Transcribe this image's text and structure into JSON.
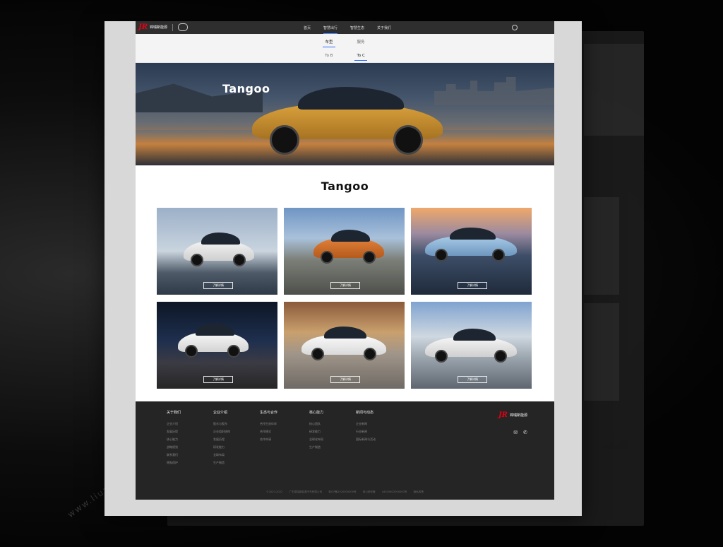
{
  "header": {
    "logo_mark": "JR",
    "logo_text": "锦瑞新能源",
    "nav": [
      "首页",
      "智慧出行",
      "智慧生态",
      "关于我们"
    ],
    "active_nav": 1
  },
  "tabs_primary": [
    "车型",
    "服务"
  ],
  "tabs_secondary": [
    "To B",
    "To C"
  ],
  "hero": {
    "brand": "Tangoo"
  },
  "section": {
    "title": "Tangoo"
  },
  "cards": [
    {
      "button": "了解详情"
    },
    {
      "button": "了解详情"
    },
    {
      "button": "了解详情"
    },
    {
      "button": "了解详情"
    },
    {
      "button": "了解详情"
    },
    {
      "button": "了解详情"
    }
  ],
  "footer": {
    "columns": [
      {
        "heading": "关于我们",
        "items": [
          "企业介绍",
          "发展历程",
          "核心能力",
          "战略规划",
          "联系我们",
          "隐私保护"
        ]
      },
      {
        "heading": "企业介绍",
        "items": [
          "股东与股东",
          "企业组织结构",
          "发展历程",
          "研发能力",
          "全球布局",
          "生产制造"
        ]
      },
      {
        "heading": "生态与合作",
        "items": [
          "合作生态伙伴",
          "合作模式",
          "合作申请"
        ]
      },
      {
        "heading": "核心能力",
        "items": [
          "核心团队",
          "研发能力",
          "全球化布局",
          "生产制造"
        ]
      },
      {
        "heading": "新闻与动态",
        "items": [
          "企业新闻",
          "行业新闻",
          "国际新闻与活动"
        ]
      }
    ],
    "logo_mark": "JR",
    "logo_text": "锦瑞新能源",
    "copyright": "©2020-2022 广东锦瑞新能源汽车有限公司 粤ICP备2020000000号 粤公网安备 44010602000000号 隐私政策"
  }
}
